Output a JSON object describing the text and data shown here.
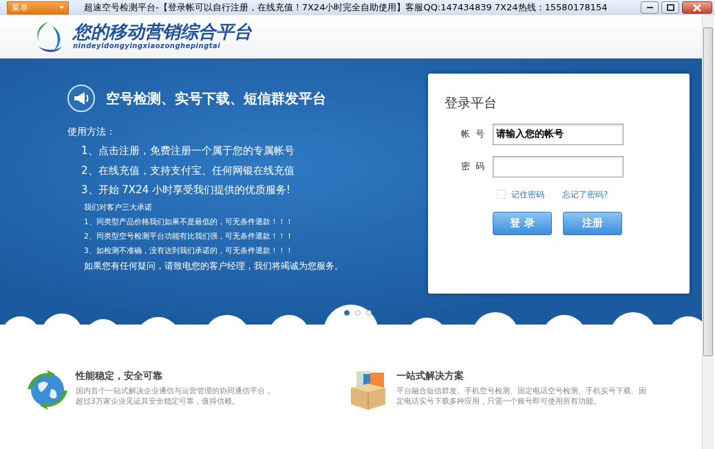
{
  "window": {
    "menu_button": "菜单",
    "title": "超速空号检测平台-【登录帐可以自行注册，在线充值！7X24小时完全自助使用】客服QQ:147434839  7X24热线：15580178154"
  },
  "header": {
    "logo_title": "您的移动营销综合平台",
    "logo_subtitle": "nindeyidongyingxiaozonghepingtai"
  },
  "banner": {
    "headline": "空号检测、实号下载、短信群发平台",
    "usage_title": "使用方法：",
    "usage_steps": [
      "1、点击注册，免费注册一个属于您的专属帐号",
      "2、在线充值，支持支付宝、任何网银在线充值",
      "3、开始 7X24 小时享受我们提供的优质服务!"
    ],
    "promise_title": "我们对客户三大承诺",
    "promises": [
      "1、同类型产品价格我们如果不是最低的，可无条件退款！！！",
      "2、同类型空号检测平台功能有比我们强，可无条件退款！！！",
      "3、如检测不准确，没有达到我们承诺的，可无条件退款！！！"
    ],
    "closing": "如果您有任何疑问，请致电您的客户经理，我们将竭诚为您服务。",
    "slides": [
      {
        "selected": true
      },
      {
        "selected": false
      },
      {
        "selected": false
      }
    ]
  },
  "login": {
    "title": "登录平台",
    "account_label": "帐  号",
    "account": {
      "value": "请输入您的帐号"
    },
    "password_label": "密  码",
    "remember": {
      "label": "记住密码",
      "checked": false
    },
    "forgot_link": "忘记了密码?",
    "buttons": [
      "登 录",
      "注册"
    ]
  },
  "features": [
    {
      "kind": "globe",
      "title": "性能稳定，安全可靠",
      "lines": [
        "国内首个一站式解决企业通信与运营管理的协同通信平台，",
        "超过3万家企业见证其安全稳定可靠，值得信赖。"
      ]
    },
    {
      "kind": "box",
      "title": "一站式解决方案",
      "lines": [
        "平台融合短信群发、手机空号检测、固定电话空号检测、手机实号下载、固",
        "定电话实号下载多种应用，只需一个账号即可使用所有功能。"
      ]
    }
  ]
}
